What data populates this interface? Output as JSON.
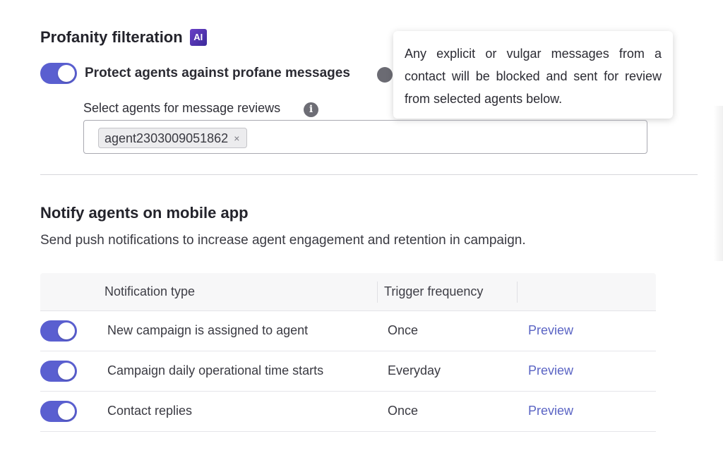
{
  "profanity": {
    "title": "Profanity filteration",
    "ai_badge": "AI",
    "toggle_label": "Protect agents against profane messages",
    "toggle_on": true,
    "tooltip": "Any explicit or vulgar messages from a contact will be blocked and sent for review from selected agents below.",
    "select_label": "Select agents for message reviews",
    "selected_agents": [
      "agent2303009051862"
    ],
    "chip_remove": "×"
  },
  "notify": {
    "title": "Notify agents on mobile app",
    "subtitle": "Send push notifications to increase agent engagement and retention in campaign.",
    "columns": [
      "Notification type",
      "Trigger frequency"
    ],
    "rows": [
      {
        "enabled": true,
        "type": "New campaign is assigned to agent",
        "frequency": "Once",
        "action": "Preview"
      },
      {
        "enabled": true,
        "type": "Campaign daily operational time starts",
        "frequency": "Everyday",
        "action": "Preview"
      },
      {
        "enabled": true,
        "type": "Contact replies",
        "frequency": "Once",
        "action": "Preview"
      }
    ]
  },
  "icons": {
    "info": "i",
    "help": "help-circle-icon"
  },
  "colors": {
    "accent": "#5a5fd0",
    "link": "#5a64c4",
    "ai_badge": "#4b34b0"
  }
}
